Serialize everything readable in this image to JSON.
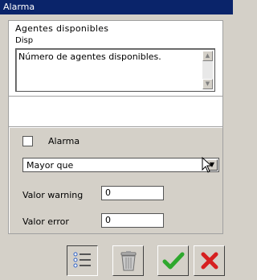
{
  "window": {
    "title": "Alarma"
  },
  "header_panel": {
    "title": "Agentes disponibles",
    "subtitle": "Disp",
    "description": "Número de agentes disponibles."
  },
  "alarm": {
    "checkbox_label": "Alarma",
    "checked": false,
    "comparison": {
      "selected": "Mayor que"
    },
    "warning": {
      "label": "Valor warning",
      "value": "0"
    },
    "error": {
      "label": "Valor error",
      "value": "0"
    }
  },
  "toolbar": {
    "buttons": [
      {
        "icon": "list-icon"
      },
      {
        "icon": "trash-icon"
      },
      {
        "icon": "check-icon",
        "color": "#2ea82e"
      },
      {
        "icon": "cross-icon",
        "color": "#d62020"
      }
    ]
  }
}
